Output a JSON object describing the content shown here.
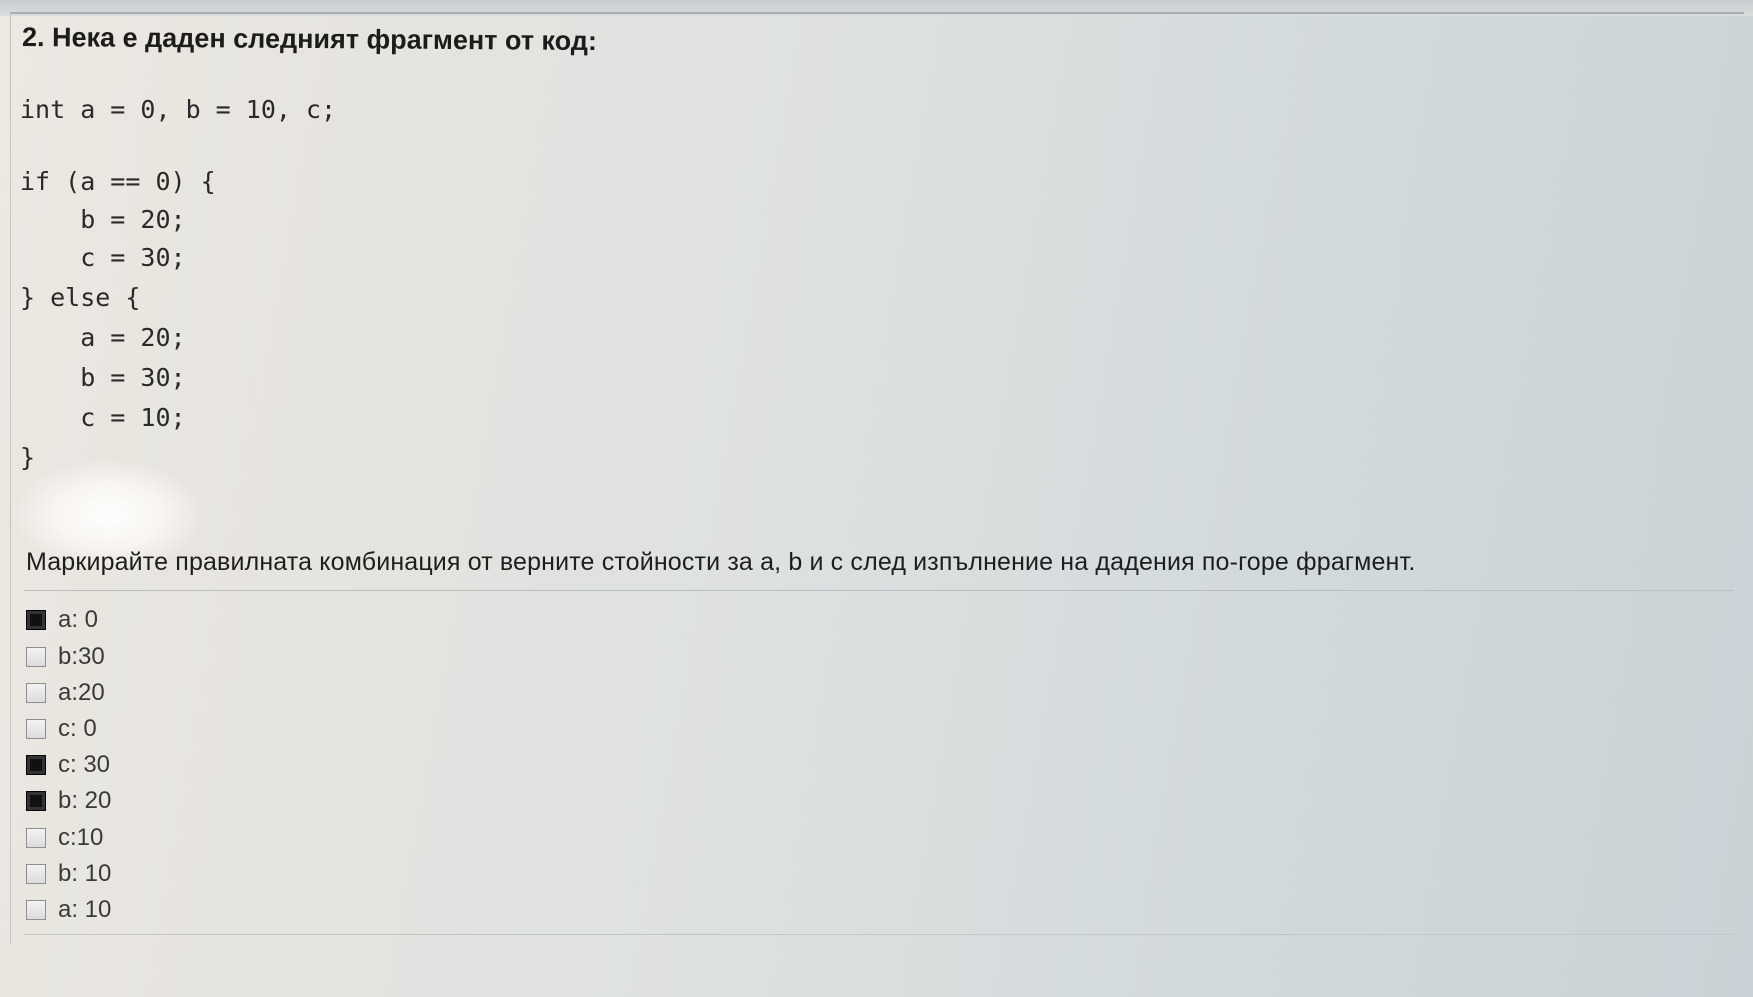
{
  "question": {
    "title": "2. Нека е даден следният фрагмент от код:",
    "code_lines": [
      "int a = 0, b = 10, c;",
      "",
      "if (a == 0) {",
      "    b = 20;",
      "    c = 30;",
      "} else {",
      "    a = 20;",
      "    b = 30;",
      "    c = 10;",
      "}"
    ],
    "instruction": "Маркирайте правилната комбинация от верните стойности за a, b и c след изпълнение на дадения по-горе фрагмент."
  },
  "options": [
    {
      "label": "a: 0",
      "checked": true
    },
    {
      "label": "b:30",
      "checked": false
    },
    {
      "label": "a:20",
      "checked": false
    },
    {
      "label": "c: 0",
      "checked": false
    },
    {
      "label": "c: 30",
      "checked": true
    },
    {
      "label": "b: 20",
      "checked": true
    },
    {
      "label": "c:10",
      "checked": false
    },
    {
      "label": "b: 10",
      "checked": false
    },
    {
      "label": "a: 10",
      "checked": false
    }
  ],
  "colors": {
    "checked_box": "#111111",
    "text": "#1e1e1e"
  }
}
